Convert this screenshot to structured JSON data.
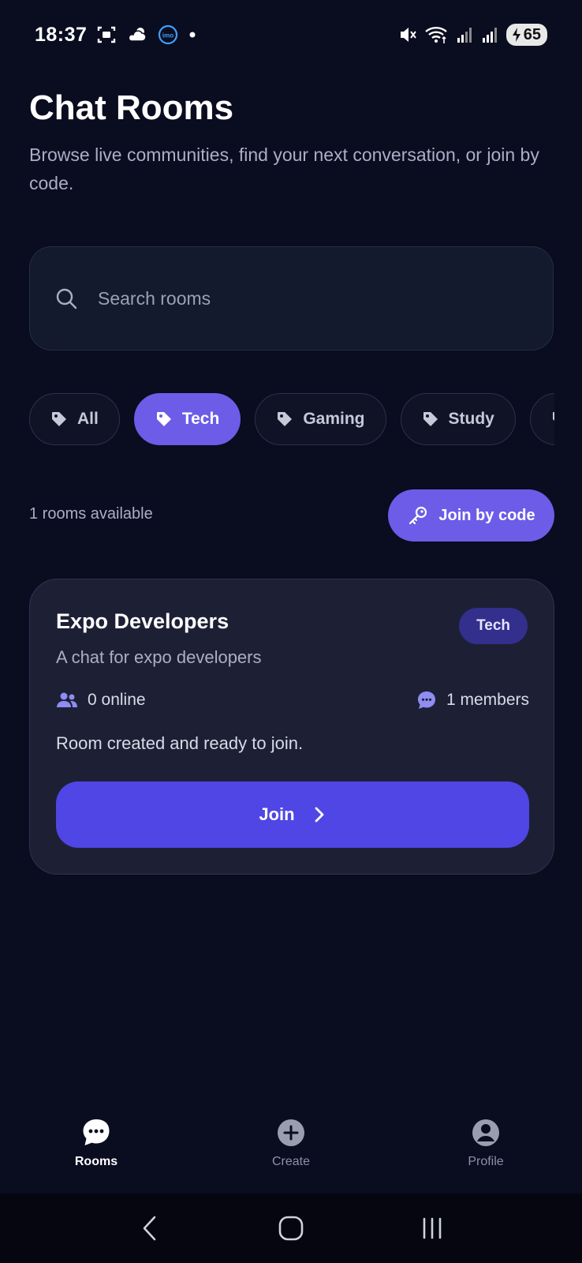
{
  "status_bar": {
    "time": "18:37",
    "battery": "65",
    "icons": [
      "screenshot-icon",
      "weather-icon",
      "imo-icon",
      "dot-icon",
      "mute-icon",
      "wifi-icon",
      "signal-icon",
      "signal-icon",
      "battery-icon"
    ],
    "imo_label": "imo"
  },
  "header": {
    "title": "Chat Rooms",
    "subtitle": "Browse live communities, find your next conversation, or join by code."
  },
  "search": {
    "placeholder": "Search rooms",
    "value": ""
  },
  "categories": [
    {
      "label": "All",
      "active": false
    },
    {
      "label": "Tech",
      "active": true
    },
    {
      "label": "Gaming",
      "active": false
    },
    {
      "label": "Study",
      "active": false
    },
    {
      "label": "",
      "active": false
    }
  ],
  "rooms_bar": {
    "count_text": "1 rooms available",
    "join_by_code_label": "Join by code"
  },
  "rooms": [
    {
      "name": "Expo Developers",
      "tag": "Tech",
      "description": "A chat for expo developers",
      "online": "0 online",
      "members": "1 members",
      "status": "Room created and ready to join.",
      "join_label": "Join"
    }
  ],
  "tabs": [
    {
      "label": "Rooms",
      "icon": "chat-bubble-icon",
      "active": true
    },
    {
      "label": "Create",
      "icon": "plus-circle-icon",
      "active": false
    },
    {
      "label": "Profile",
      "icon": "user-circle-icon",
      "active": false
    }
  ],
  "colors": {
    "background": "#0a0c1f",
    "accent": "#6c5ce7",
    "join_button": "#4f46e5",
    "card": "#1d2035"
  }
}
